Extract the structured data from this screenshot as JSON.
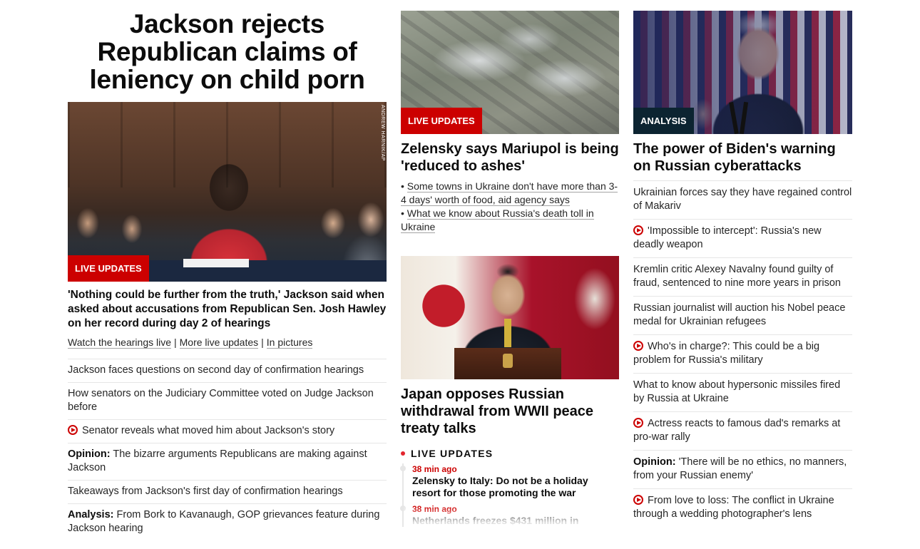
{
  "hero": {
    "title": "Jackson rejects Republican claims of leniency on child porn",
    "image_credit": "ANDREW HARNIK/AP",
    "badge": "LIVE UPDATES",
    "headline": "'Nothing could be further from the truth,' Jackson said when asked about accusations from Republican Sen. Josh Hawley on her record during day 2 of hearings",
    "links": [
      "Watch the hearings live",
      "More live updates",
      "In pictures"
    ],
    "separator": "|"
  },
  "left_list": [
    {
      "prefix": "",
      "text": "Jackson faces questions on second day of confirmation hearings",
      "video": false
    },
    {
      "prefix": "",
      "text": "How senators on the Judiciary Committee voted on Judge Jackson before",
      "video": false
    },
    {
      "prefix": "",
      "text": "Senator reveals what moved him about Jackson's story",
      "video": true
    },
    {
      "prefix": "Opinion:",
      "text": "The bizarre arguments Republicans are making against Jackson",
      "video": false
    },
    {
      "prefix": "",
      "text": "Takeaways from Jackson's first day of confirmation hearings",
      "video": false
    },
    {
      "prefix": "Analysis:",
      "text": "From Bork to Kavanaugh, GOP grievances feature during Jackson hearing",
      "video": false
    }
  ],
  "mariupol": {
    "badge": "LIVE UPDATES",
    "title": "Zelensky says Mariupol is being 'reduced to ashes'",
    "bullets": [
      "Some towns in Ukraine don't have more than 3-4 days' worth of food, aid agency says",
      "What we know about Russia's death toll in Ukraine"
    ],
    "bullet_char": "•"
  },
  "japan": {
    "title": "Japan opposes Russian withdrawal from WWII peace treaty talks"
  },
  "live_updates": {
    "heading": "LIVE UPDATES",
    "entries": [
      {
        "time": "38 min ago",
        "text": "Zelensky to Italy: Do not be a holiday resort for those promoting the war"
      },
      {
        "time": "38 min ago",
        "text": "Netherlands freezes $431 million in"
      }
    ]
  },
  "biden": {
    "badge": "ANALYSIS",
    "title": "The power of Biden's warning on Russian cyberattacks"
  },
  "right_list": [
    {
      "prefix": "",
      "text": "Ukrainian forces say they have regained control of Makariv",
      "video": false
    },
    {
      "prefix": "",
      "text": "'Impossible to intercept': Russia's new deadly weapon",
      "video": true
    },
    {
      "prefix": "",
      "text": "Kremlin critic Alexey Navalny found guilty of fraud, sentenced to nine more years in prison",
      "video": false
    },
    {
      "prefix": "",
      "text": "Russian journalist will auction his Nobel peace medal for Ukrainian refugees",
      "video": false
    },
    {
      "prefix": "",
      "text": "Who's in charge?: This could be a big problem for Russia's military",
      "video": true
    },
    {
      "prefix": "",
      "text": "What to know about hypersonic missiles fired by Russia at Ukraine",
      "video": false
    },
    {
      "prefix": "",
      "text": "Actress reacts to famous dad's remarks at pro-war rally",
      "video": true
    },
    {
      "prefix": "Opinion:",
      "text": "'There will be no ethics, no manners, from your Russian enemy'",
      "video": false
    },
    {
      "prefix": "",
      "text": "From love to loss: The conflict in Ukraine through a wedding photographer's lens",
      "video": true
    }
  ],
  "colors": {
    "accent_red": "#cc0000",
    "badge_dark": "#0c2431",
    "text": "#0c0c0c",
    "divider": "#e6e6e6"
  },
  "icons": {
    "video": "play-circle-icon",
    "live": "live-dot-icon"
  }
}
